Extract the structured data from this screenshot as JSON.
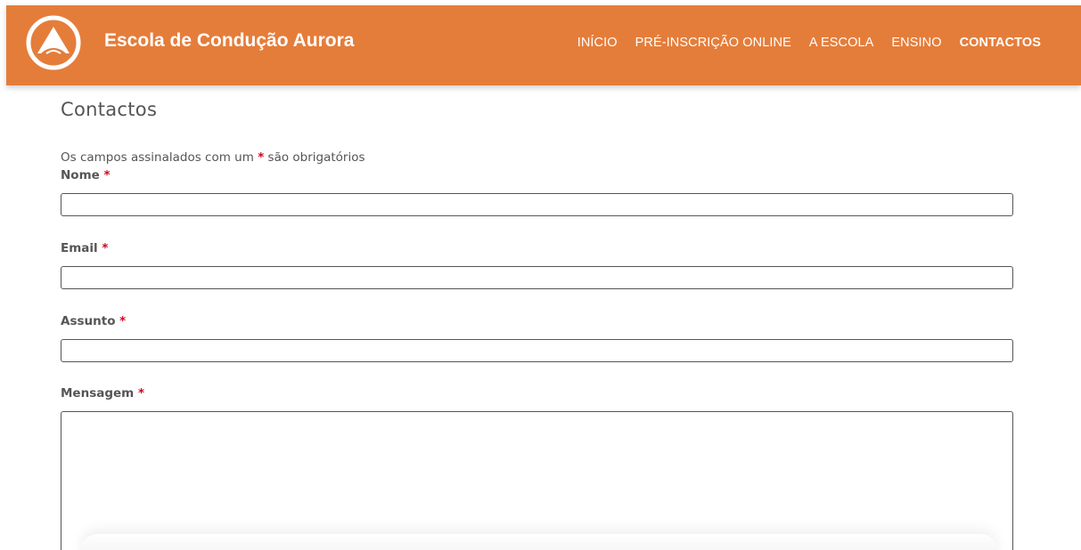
{
  "header": {
    "brand": "Escola de Condução Aurora",
    "logo_icon": "mountain-road-logo-icon",
    "background_color": "#e57d3a",
    "nav": [
      {
        "label": "INÍCIO",
        "active": false
      },
      {
        "label": "PRÉ-INSCRIÇÃO ONLINE",
        "active": false
      },
      {
        "label": "A ESCOLA",
        "active": false
      },
      {
        "label": "ENSINO",
        "active": false
      },
      {
        "label": "CONTACTOS",
        "active": true
      }
    ]
  },
  "main": {
    "title": "Contactos",
    "required_note_before": "Os campos assinalados com um",
    "required_star": "*",
    "required_note_after": "são obrigatórios",
    "required_color": "#d0021b",
    "form": {
      "fields": [
        {
          "label": "Nome",
          "value": "",
          "type": "text"
        },
        {
          "label": "Email",
          "value": "",
          "type": "text"
        },
        {
          "label": "Assunto",
          "value": "",
          "type": "text"
        },
        {
          "label": "Mensagem",
          "value": "",
          "type": "textarea"
        }
      ]
    }
  }
}
